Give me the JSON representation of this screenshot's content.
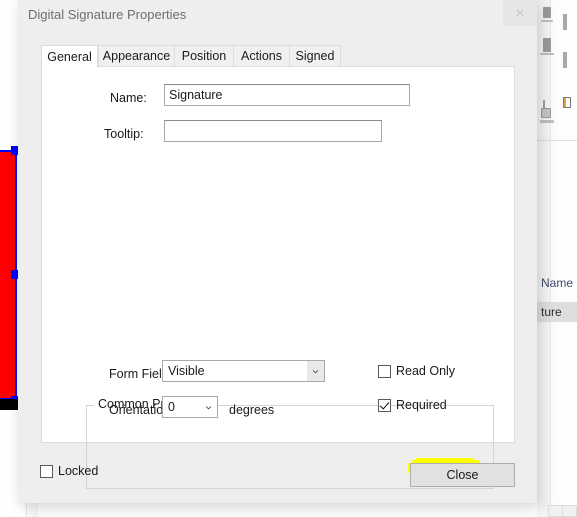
{
  "background": {
    "column_header": "Name",
    "selected_cell_text": "ture",
    "canvas_field_name": "signature-field-selection"
  },
  "dialog": {
    "title": "Digital Signature Properties",
    "close_icon": "close-icon",
    "tabs": [
      {
        "label": "General",
        "active": true
      },
      {
        "label": "Appearance",
        "active": false
      },
      {
        "label": "Position",
        "active": false
      },
      {
        "label": "Actions",
        "active": false
      },
      {
        "label": "Signed",
        "active": false
      }
    ],
    "general": {
      "name_label": "Name:",
      "name_value": "Signature",
      "tooltip_label": "Tooltip:",
      "tooltip_value": ""
    },
    "common_properties": {
      "group_title": "Common Properties",
      "form_field_label": "Form Field:",
      "form_field_value": "Visible",
      "form_field_options": [
        "Visible"
      ],
      "orientation_label": "Orientation:",
      "orientation_value": "0",
      "orientation_options": [
        "0"
      ],
      "degrees_label": "degrees",
      "read_only_label": "Read Only",
      "read_only_checked": false,
      "required_label": "Required",
      "required_checked": true,
      "required_highlight_color": "#ffff00"
    },
    "footer": {
      "locked_label": "Locked",
      "locked_checked": false,
      "close_label": "Close"
    }
  }
}
